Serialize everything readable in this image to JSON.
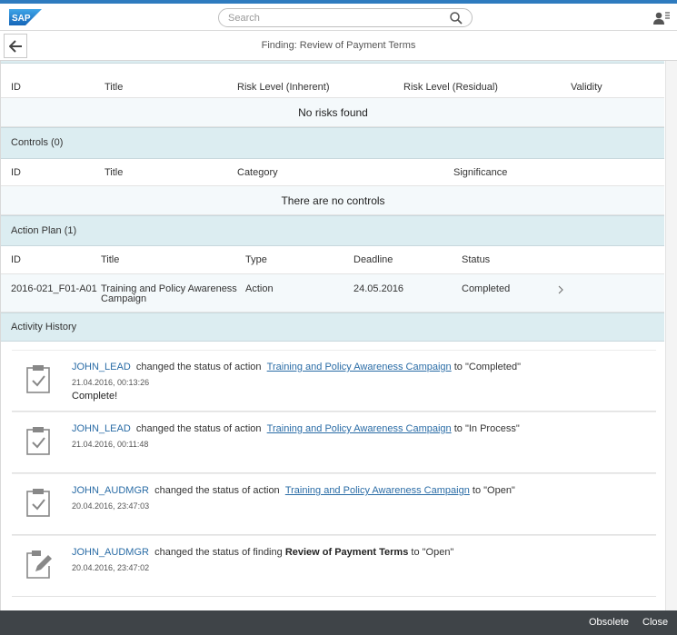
{
  "shell": {
    "logo_text": "SAP",
    "search_placeholder": "Search",
    "brand_color": "#2e7bbf"
  },
  "header": {
    "title": "Finding: Review of Payment Terms"
  },
  "risks": {
    "columns": [
      "ID",
      "Title",
      "Risk Level (Inherent)",
      "Risk Level (Residual)",
      "Validity"
    ],
    "empty_text": "No risks found"
  },
  "controls": {
    "section_title": "Controls (0)",
    "columns": [
      "ID",
      "Title",
      "Category",
      "Significance"
    ],
    "empty_text": "There are no controls"
  },
  "action_plan": {
    "section_title": "Action Plan (1)",
    "columns": [
      "ID",
      "Title",
      "Type",
      "Deadline",
      "Status"
    ],
    "rows": [
      {
        "id": "2016-021_F01-A01",
        "title_line1": "Training and Policy Awareness",
        "title_line2": "Campaign",
        "type": "Action",
        "deadline": "24.05.2016",
        "status": "Completed"
      }
    ]
  },
  "activity": {
    "section_title": "Activity History",
    "items": [
      {
        "user": "JOHN_LEAD",
        "text": "changed the status of action",
        "link": "Training and Policy Awareness Campaign",
        "suffix": "to \"Completed\"",
        "time": "21.04.2016, 00:13:26",
        "note": "Complete!",
        "icon": "clipboard-check-icon"
      },
      {
        "user": "JOHN_LEAD",
        "text": "changed the status of action",
        "link": "Training and Policy Awareness Campaign",
        "suffix": "to \"In Process\"",
        "time": "21.04.2016, 00:11:48",
        "icon": "clipboard-check-icon"
      },
      {
        "user": "JOHN_AUDMGR",
        "text": "changed the status of action",
        "link": "Training and Policy Awareness Campaign",
        "suffix": "to \"Open\"",
        "time": "20.04.2016, 23:47:03",
        "icon": "clipboard-check-icon"
      },
      {
        "user": "JOHN_AUDMGR",
        "text": "changed the status of finding",
        "bold": "Review of Payment Terms",
        "suffix": "to \"Open\"",
        "time": "20.04.2016, 23:47:02",
        "icon": "edit-note-icon"
      }
    ]
  },
  "footer": {
    "obsolete_label": "Obsolete",
    "close_label": "Close"
  }
}
